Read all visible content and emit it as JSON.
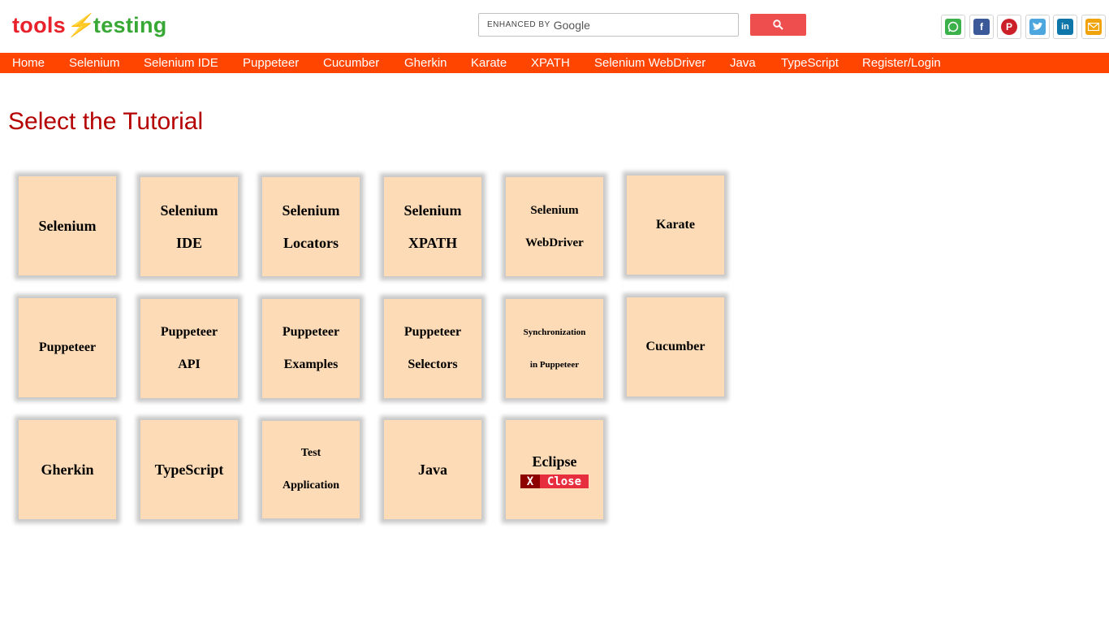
{
  "logo": {
    "part1": "tools",
    "part2": "⚡",
    "part3": "testing"
  },
  "search": {
    "enhanced_label": "ENHANCED BY",
    "brand": "Google"
  },
  "nav": {
    "items": [
      "Home",
      "Selenium",
      "Selenium IDE",
      "Puppeteer",
      "Cucumber",
      "Gherkin",
      "Karate",
      "XPATH",
      "Selenium WebDriver",
      "Java",
      "TypeScript",
      "Register/Login"
    ]
  },
  "page": {
    "title": "Select the Tutorial"
  },
  "cards": {
    "selenium": {
      "l1": "Selenium"
    },
    "selenium_ide": {
      "l1": "Selenium",
      "l2": "IDE"
    },
    "selenium_locators": {
      "l1": "Selenium",
      "l2": "Locators"
    },
    "selenium_xpath": {
      "l1": "Selenium",
      "l2": "XPATH"
    },
    "selenium_webdriver": {
      "l1": "Selenium",
      "l2": "WebDriver"
    },
    "karate": {
      "l1": "Karate"
    },
    "puppeteer": {
      "l1": "Puppeteer"
    },
    "puppeteer_api": {
      "l1": "Puppeteer",
      "l2": "API"
    },
    "puppeteer_examples": {
      "l1": "Puppeteer",
      "l2": "Examples"
    },
    "puppeteer_selectors": {
      "l1": "Puppeteer",
      "l2": "Selectors"
    },
    "sync_puppeteer": {
      "l1": "Synchronization",
      "l2": "in Puppeteer"
    },
    "cucumber": {
      "l1": "Cucumber"
    },
    "gherkin": {
      "l1": "Gherkin"
    },
    "typescript": {
      "l1": "TypeScript"
    },
    "test_application": {
      "l1": "Test",
      "l2": "Application"
    },
    "java": {
      "l1": "Java"
    },
    "eclipse": {
      "l1": "Eclipse"
    }
  },
  "close_button": {
    "x": "X",
    "label": "Close"
  },
  "social": [
    "whatsapp-icon",
    "facebook-icon",
    "pinterest-icon",
    "twitter-icon",
    "linkedin-icon",
    "email-icon"
  ],
  "colors": {
    "nav_bg": "#ff4500",
    "title": "#b40000",
    "card_bg": "#fcdbb6",
    "search_button": "#ee4e4e"
  }
}
